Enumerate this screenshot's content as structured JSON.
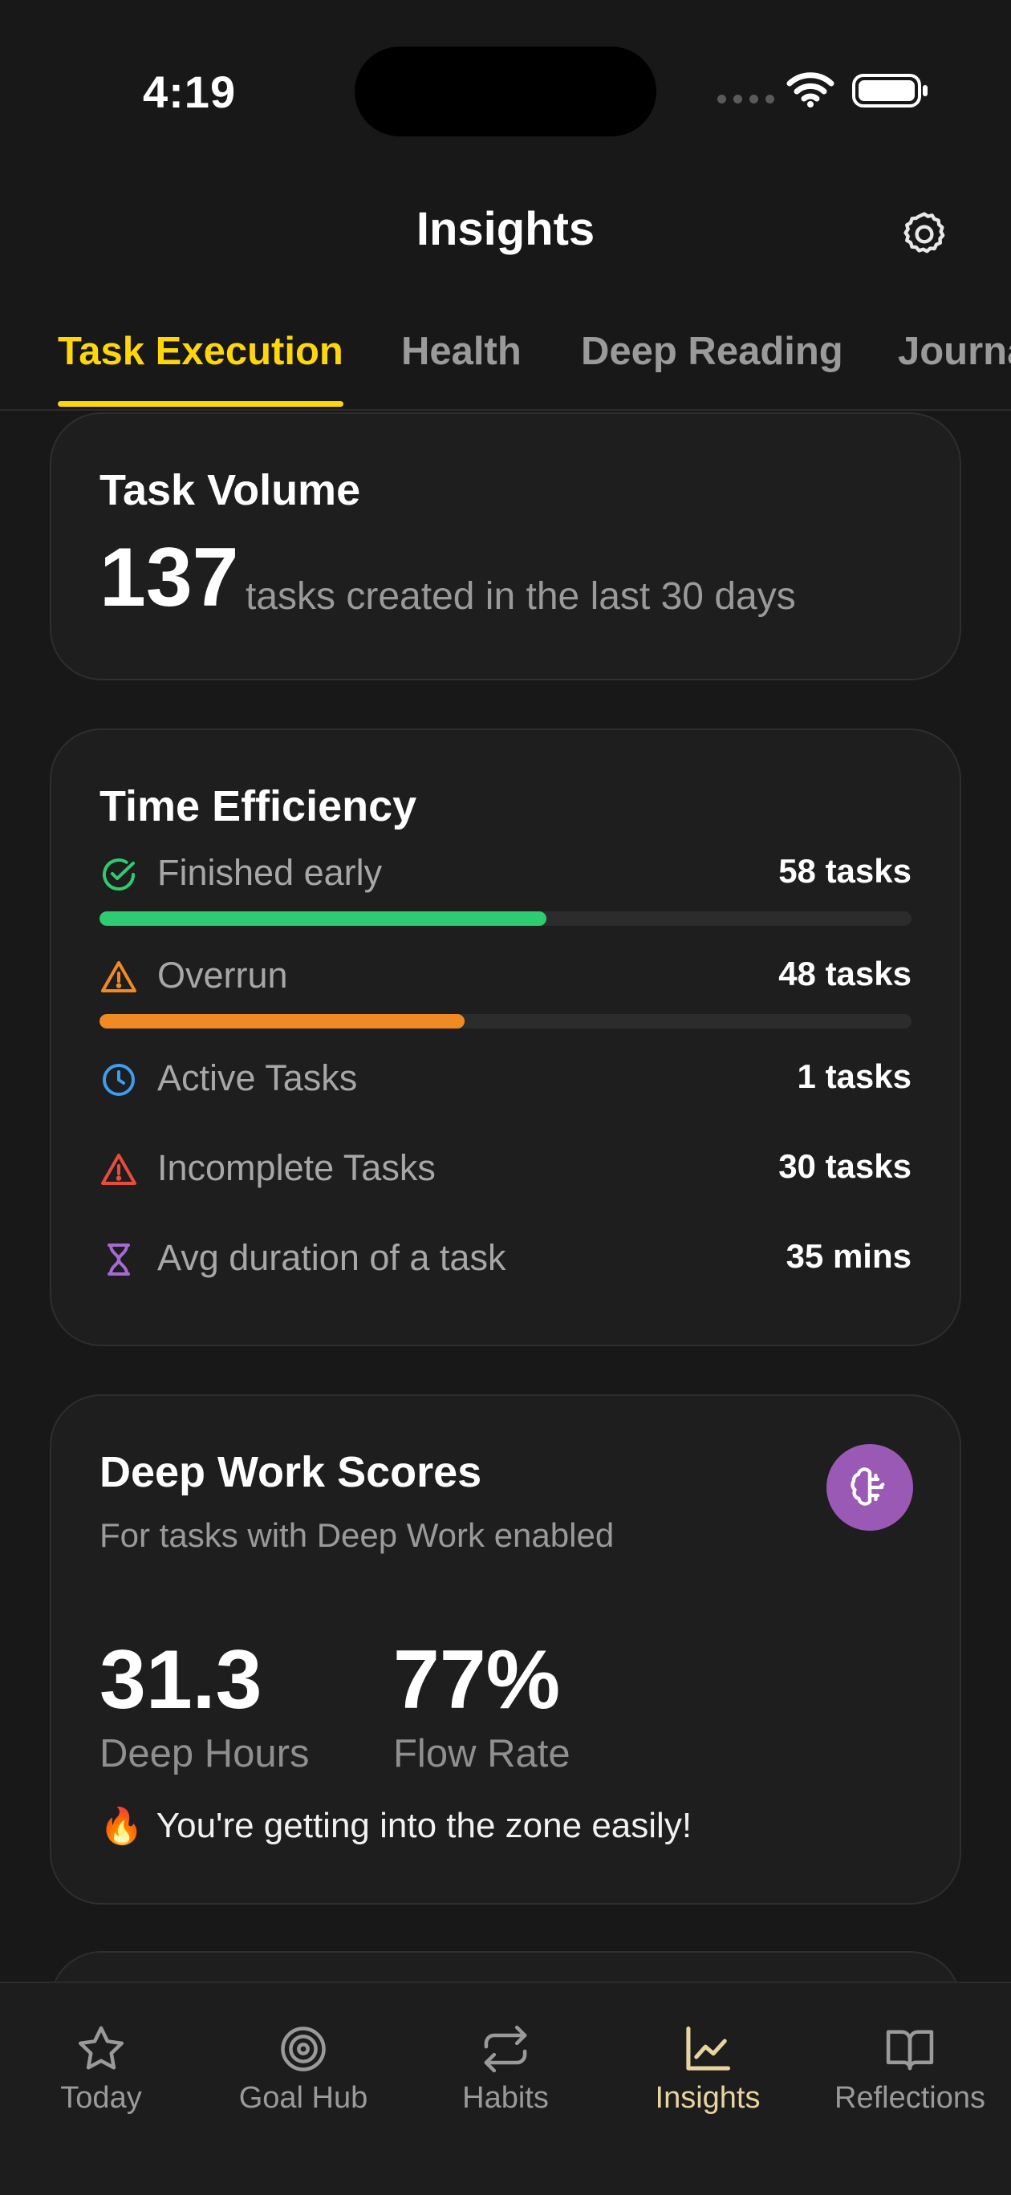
{
  "status_bar": {
    "time": "4:19"
  },
  "header": {
    "title": "Insights"
  },
  "tabs": [
    {
      "label": "Task Execution",
      "active": true
    },
    {
      "label": "Health",
      "active": false
    },
    {
      "label": "Deep Reading",
      "active": false
    },
    {
      "label": "Journal",
      "active": false
    }
  ],
  "task_volume": {
    "title": "Task Volume",
    "count": "137",
    "caption": "tasks created in the last 30 days"
  },
  "time_efficiency": {
    "title": "Time Efficiency",
    "rows": [
      {
        "label": "Finished early",
        "value": "58 tasks",
        "icon": "check-circle-icon",
        "color": "#2ECC71",
        "progress": 0.55
      },
      {
        "label": "Overrun",
        "value": "48 tasks",
        "icon": "warning-icon",
        "color": "#F08A24",
        "progress": 0.45
      },
      {
        "label": "Active Tasks",
        "value": "1 tasks",
        "icon": "clock-icon",
        "color": "#3B9EF0"
      },
      {
        "label": "Incomplete Tasks",
        "value": "30 tasks",
        "icon": "alert-icon",
        "color": "#E74C3C"
      },
      {
        "label": "Avg duration of a task",
        "value": "35 mins",
        "icon": "hourglass-icon",
        "color": "#A66AD4"
      }
    ]
  },
  "deep_work": {
    "title": "Deep Work Scores",
    "subtitle": "For tasks with Deep Work enabled",
    "badge_icon": "brain-icon",
    "badge_color": "#9B59B6",
    "stats": [
      {
        "value": "31.3",
        "label": "Deep Hours"
      },
      {
        "value": "77%",
        "label": "Flow Rate"
      }
    ],
    "message_emoji": "🔥",
    "message": "You're getting into the zone easily!"
  },
  "bottom_nav": [
    {
      "label": "Today",
      "icon": "star-icon",
      "active": false
    },
    {
      "label": "Goal Hub",
      "icon": "target-icon",
      "active": false
    },
    {
      "label": "Habits",
      "icon": "repeat-icon",
      "active": false
    },
    {
      "label": "Insights",
      "icon": "chart-icon",
      "active": true
    },
    {
      "label": "Reflections",
      "icon": "book-icon",
      "active": false
    }
  ],
  "colors": {
    "accent": "#FFD60A",
    "active_nav": "#E8D4A0",
    "background": "#181818",
    "card": "#1E1E1E"
  }
}
